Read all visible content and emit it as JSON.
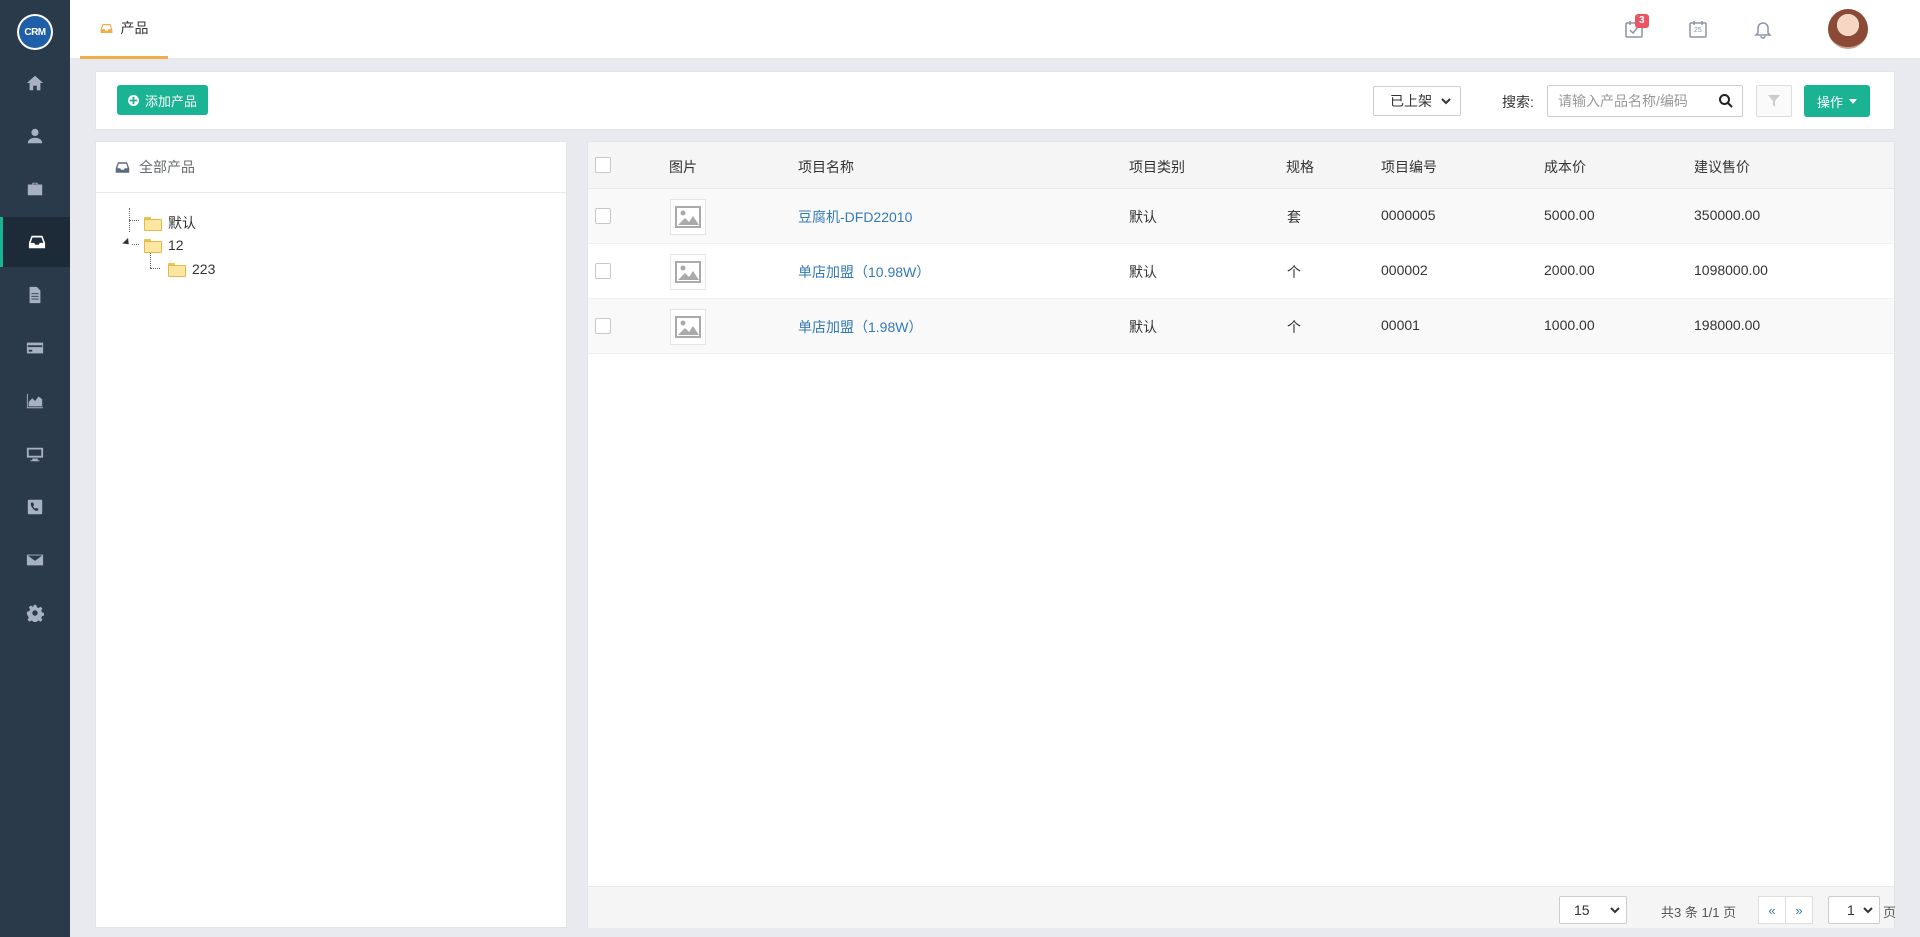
{
  "app": {
    "logo_text": "CRM"
  },
  "sidebar": {
    "items": [
      {
        "icon": "home-icon"
      },
      {
        "icon": "user-icon"
      },
      {
        "icon": "briefcase-icon"
      },
      {
        "icon": "inbox-icon",
        "active": true
      },
      {
        "icon": "document-icon"
      },
      {
        "icon": "credit-card-icon"
      },
      {
        "icon": "area-chart-icon"
      },
      {
        "icon": "desktop-icon"
      },
      {
        "icon": "phone-icon"
      },
      {
        "icon": "envelope-icon"
      },
      {
        "icon": "gear-icon"
      }
    ]
  },
  "header": {
    "tab_label": "产品",
    "task_badge": "3",
    "calendar_day": "25"
  },
  "toolbar": {
    "add_label": "添加产品",
    "status_value": "已上架",
    "search_label": "搜索:",
    "search_placeholder": "请输入产品名称/编码",
    "ops_label": "操作"
  },
  "tree": {
    "title": "全部产品",
    "nodes": [
      {
        "label": "默认"
      },
      {
        "label": "12"
      },
      {
        "label": "223"
      }
    ]
  },
  "table": {
    "headers": [
      "图片",
      "项目名称",
      "项目类别",
      "规格",
      "项目编号",
      "成本价",
      "建议售价"
    ],
    "rows": [
      {
        "name": "豆腐机-DFD22010",
        "category": "默认",
        "spec": "套",
        "code": "0000005",
        "cost": "5000.00",
        "price": "350000.00"
      },
      {
        "name": "单店加盟（10.98W）",
        "category": "默认",
        "spec": "个",
        "code": "000002",
        "cost": "2000.00",
        "price": "1098000.00"
      },
      {
        "name": "单店加盟（1.98W）",
        "category": "默认",
        "spec": "个",
        "code": "00001",
        "cost": "1000.00",
        "price": "198000.00"
      }
    ]
  },
  "pager": {
    "page_size": "15",
    "info": "共3 条 1/1 页",
    "prev": "«",
    "next": "»",
    "current": "1",
    "suffix": "页"
  }
}
